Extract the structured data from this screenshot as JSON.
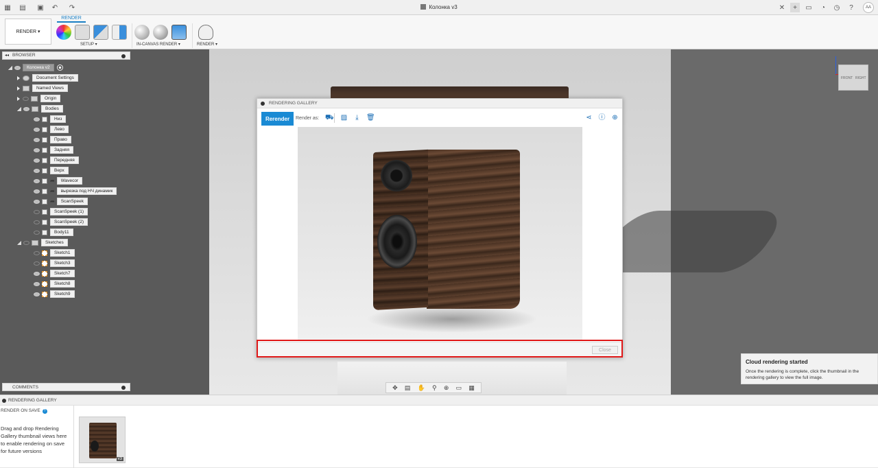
{
  "titlebar": {
    "doc_title": "Колонка v3",
    "user_initials": "AA"
  },
  "ribbon": {
    "workspace_select": "RENDER ▾",
    "active_tab": "RENDER",
    "groups": [
      {
        "label": "SETUP ▾"
      },
      {
        "label": "IN-CANVAS RENDER ▾"
      },
      {
        "label": "RENDER ▾"
      }
    ]
  },
  "browser": {
    "header": "BROWSER",
    "root": "Колонка v2",
    "nodes": [
      {
        "label": "Document Settings"
      },
      {
        "label": "Named Views"
      },
      {
        "label": "Origin"
      },
      {
        "label": "Bodies"
      },
      {
        "label": "Низ"
      },
      {
        "label": "Лево"
      },
      {
        "label": "Право"
      },
      {
        "label": "Задняя"
      },
      {
        "label": "Передняя"
      },
      {
        "label": "Верх"
      },
      {
        "label": "Wavecor"
      },
      {
        "label": "вырезка под НЧ динамик"
      },
      {
        "label": "ScanSpeek"
      },
      {
        "label": "ScanSpeek (1)"
      },
      {
        "label": "ScanSpeek (2)"
      },
      {
        "label": "Body11"
      },
      {
        "label": "Sketches"
      },
      {
        "label": "Sketch1"
      },
      {
        "label": "Sketch3"
      },
      {
        "label": "Sketch7"
      },
      {
        "label": "Sketch8"
      },
      {
        "label": "Sketch9"
      }
    ]
  },
  "comments": {
    "header": "COMMENTS"
  },
  "viewcube": {
    "front": "FRONT",
    "right": "RIGHT"
  },
  "dialog": {
    "title": "RENDERING GALLERY",
    "rerender_label": "Rerender",
    "render_as_label": "Render as:",
    "close_label": "Close"
  },
  "toast": {
    "title": "Cloud rendering started",
    "body": "Once the rendering is complete, click the thumbnail in the rendering gallery to view the full image."
  },
  "gallery": {
    "title": "RENDERING GALLERY",
    "render_on_save": "RENDER ON SAVE",
    "hint": "Drag and drop Rendering Gallery thumbnail views here to enable rendering on save for future versions",
    "thumbnail_version": "v3"
  },
  "colors": {
    "accent": "#1a8ad4",
    "highlight": "#e01818"
  }
}
